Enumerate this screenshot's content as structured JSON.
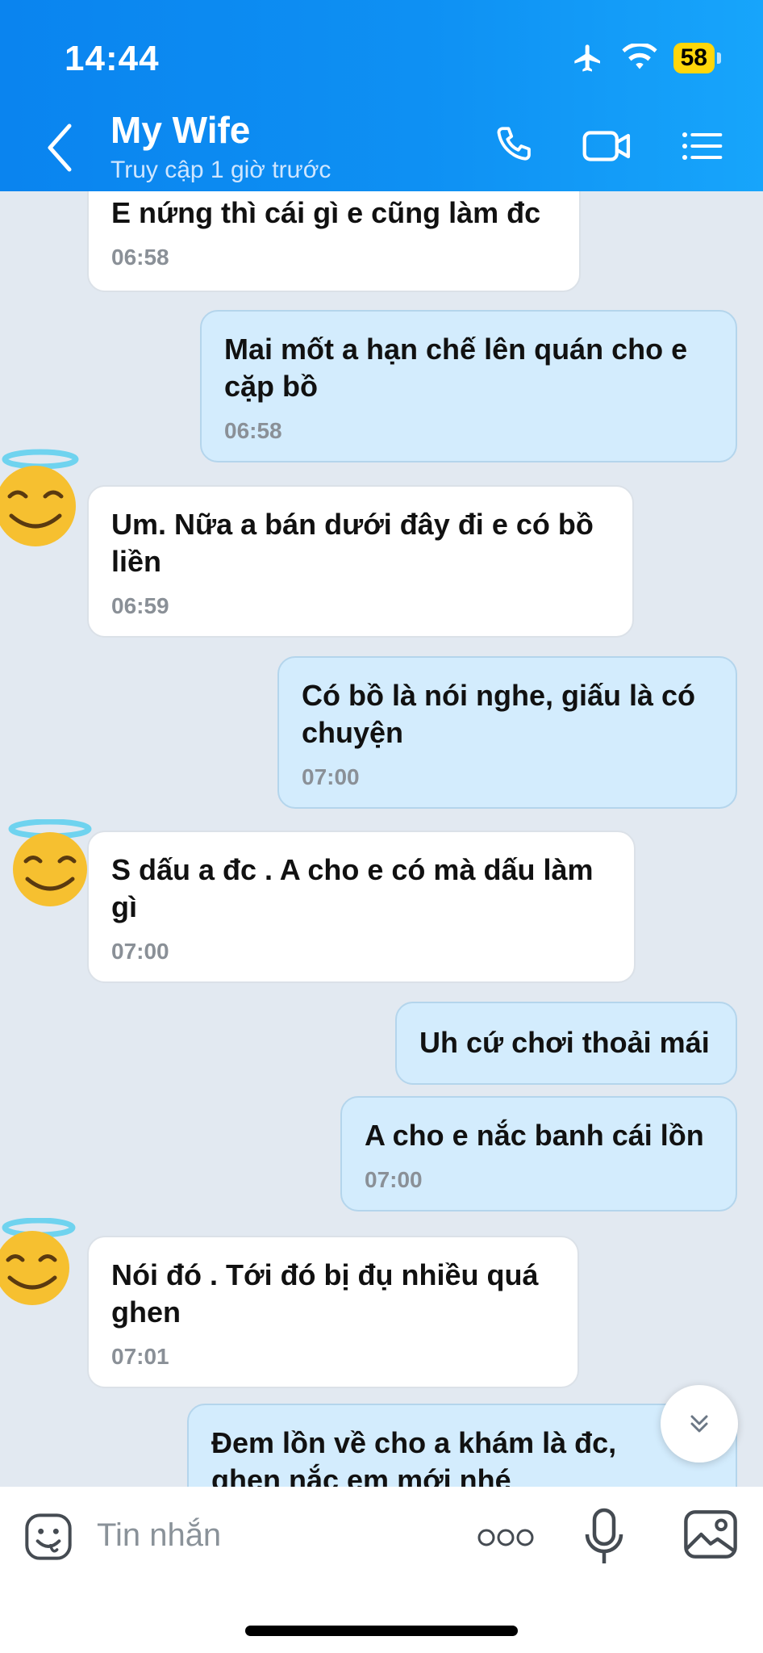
{
  "status_bar": {
    "time": "14:44",
    "battery": "58"
  },
  "header": {
    "contact_name": "My Wife",
    "contact_status": "Truy cập 1 giờ trước",
    "icons": [
      "back-icon",
      "phone-icon",
      "video-call-icon",
      "menu-list-icon"
    ]
  },
  "messages": [
    {
      "side": "in",
      "text": "E nứng thì cái gì e cũng làm đc",
      "time": "06:58"
    },
    {
      "side": "out",
      "text": "Mai mốt a hạn chế lên quán cho e cặp bồ",
      "time": "06:58"
    },
    {
      "side": "in",
      "text": "Um. Nữa a bán dưới đây đi e có bồ liền",
      "time": "06:59"
    },
    {
      "side": "out",
      "text": "Có bồ là nói nghe, giấu là có chuyện",
      "time": "07:00"
    },
    {
      "side": "in",
      "text": "S dấu a đc . A cho e có mà dấu làm gì",
      "time": "07:00"
    },
    {
      "side": "out",
      "text": "Uh cứ chơi thoải mái",
      "time": ""
    },
    {
      "side": "out",
      "text": "A cho e nắc banh cái lồn",
      "time": "07:00"
    },
    {
      "side": "in",
      "text": "Nói đó . Tới đó bị đụ nhiều quá ghen",
      "time": "07:01"
    },
    {
      "side": "out",
      "text": "Đem lồn về cho a khám là đc, ghen nắc em mới nhé",
      "time": ""
    }
  ],
  "input": {
    "placeholder": "Tin nhắn"
  },
  "colors": {
    "header": "#0a84ef",
    "chat_bg": "#e2e9f1",
    "outgoing_bubble": "#d3ecfd",
    "incoming_bubble": "#ffffff"
  }
}
